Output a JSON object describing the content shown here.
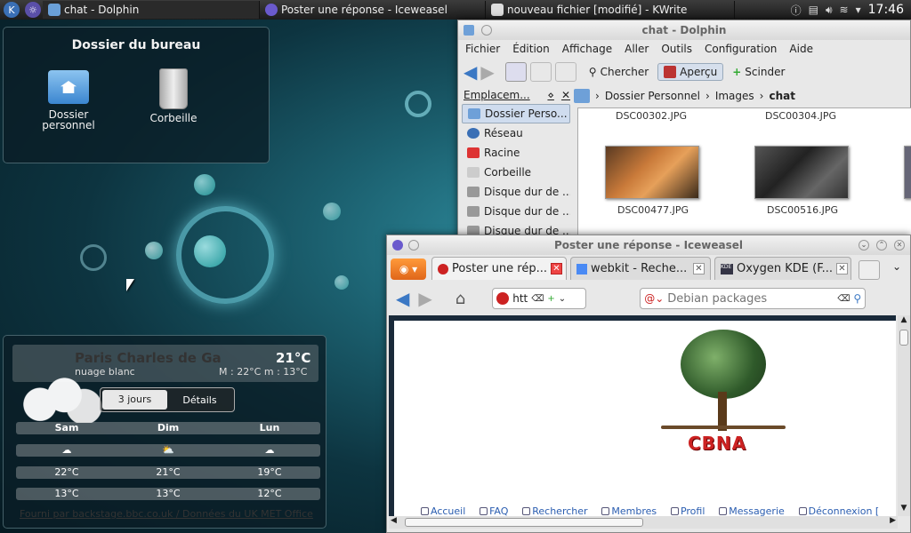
{
  "taskbar": {
    "tasks": [
      {
        "label": "chat - Dolphin"
      },
      {
        "label": "Poster une réponse - Iceweasel"
      },
      {
        "label": "nouveau fichier [modifié] - KWrite"
      }
    ],
    "clock": "17:46"
  },
  "folderview": {
    "title": "Dossier du bureau",
    "items": [
      {
        "label": "Dossier personnel"
      },
      {
        "label": "Corbeille"
      }
    ]
  },
  "weather": {
    "location": "Paris Charles de Ga",
    "temp": "21°C",
    "condition": "nuage blanc",
    "minmax": "M : 22°C m : 13°C",
    "tabs": [
      "3 jours",
      "Détails"
    ],
    "days": [
      "Sam",
      "Dim",
      "Lun"
    ],
    "highs": [
      "22°C",
      "21°C",
      "19°C"
    ],
    "lows": [
      "13°C",
      "13°C",
      "12°C"
    ],
    "footer": "Fourni par backstage.bbc.co.uk / Données du UK MET Office"
  },
  "dolphin": {
    "title": "chat - Dolphin",
    "menu": [
      "Fichier",
      "Édition",
      "Affichage",
      "Aller",
      "Outils",
      "Configuration",
      "Aide"
    ],
    "toolbar": {
      "search": "Chercher",
      "preview": "Aperçu",
      "split": "Scinder"
    },
    "places_title": "Emplacem...",
    "places": [
      "Dossier Perso...",
      "Réseau",
      "Racine",
      "Corbeille",
      "Disque dur de ...",
      "Disque dur de ...",
      "Disque dur de ..."
    ],
    "breadcrumb": [
      "Dossier Personnel",
      "Images",
      "chat"
    ],
    "files_top": [
      "DSC00302.JPG",
      "DSC00304.JPG"
    ],
    "files": [
      "DSC00477.JPG",
      "DSC00516.JPG"
    ]
  },
  "iceweasel": {
    "title": "Poster une réponse - Iceweasel",
    "tabs": [
      "Poster une rép...",
      "webkit - Reche...",
      "Oxygen KDE (F..."
    ],
    "url": "htt",
    "search_placeholder": "Debian packages",
    "logo_text": "CBNA",
    "links": [
      "Accueil",
      "FAQ",
      "Rechercher",
      "Membres",
      "Profil",
      "Messagerie",
      "Déconnexion ["
    ]
  },
  "colors": {
    "accent": "#3b78c4",
    "desktop": "#1b5f6e"
  }
}
